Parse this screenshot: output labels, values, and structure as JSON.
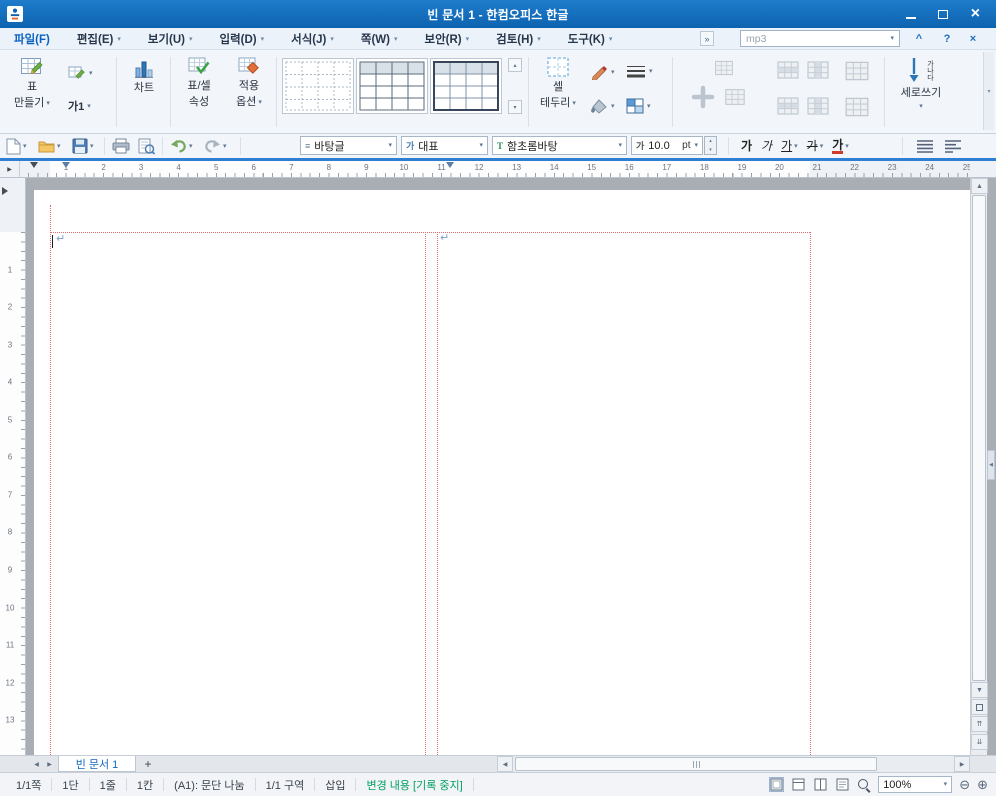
{
  "colors": {
    "titlebar_top": "#1e7ccb",
    "titlebar_bottom": "#0d63b0",
    "accent_line": "#2e7fd2",
    "margin_guide": "#e06a6a",
    "track_changes": "#00a05f",
    "file_menu": "#0b62c3"
  },
  "window": {
    "title": "빈 문서 1 - 한컴오피스 한글"
  },
  "menubar": {
    "items": [
      {
        "label": "파일(F)",
        "arrow": "",
        "key": "file"
      },
      {
        "label": "편집(E)",
        "arrow": "▾",
        "key": "edit"
      },
      {
        "label": "보기(U)",
        "arrow": "▾",
        "key": "view"
      },
      {
        "label": "입력(D)",
        "arrow": "▾",
        "key": "input"
      },
      {
        "label": "서식(J)",
        "arrow": "▾",
        "key": "format"
      },
      {
        "label": "쪽(W)",
        "arrow": "▾",
        "key": "page"
      },
      {
        "label": "보안(R)",
        "arrow": "▾",
        "key": "security"
      },
      {
        "label": "검토(H)",
        "arrow": "▾",
        "key": "review"
      },
      {
        "label": "도구(K)",
        "arrow": "▾",
        "key": "tools"
      }
    ],
    "overflow": "»",
    "search_value": "mp3",
    "collapse": "^",
    "help": "?",
    "close": "×"
  },
  "ribbon": {
    "make_table_line1": "표",
    "make_table_line2": "만들기",
    "ga1_label": "가1",
    "chart_label": "차트",
    "props_line1": "표/셀",
    "props_line2": "속성",
    "apply_line1": "적용",
    "apply_line2": "옵션",
    "cell_border_line1": "셀",
    "cell_border_line2": "테두리",
    "vertical_label": "세로쓰기",
    "vertical_icon_text": "가나다"
  },
  "toolbar": {
    "style_value": "바탕글",
    "font_type_value": "대표",
    "font_value": "함초롬바탕",
    "size_value": "10.0",
    "size_unit": "pt",
    "char_buttons": [
      {
        "label": "가",
        "kind": "bold",
        "dd": false
      },
      {
        "label": "가",
        "kind": "italic",
        "dd": false
      },
      {
        "label": "가",
        "kind": "underline",
        "dd": true
      },
      {
        "label": "가",
        "kind": "strike",
        "dd": true
      },
      {
        "label": "가",
        "kind": "color",
        "dd": true
      }
    ]
  },
  "rulers": {
    "h_numbers": [
      1,
      2,
      3,
      4,
      5,
      6,
      7,
      8,
      9,
      10,
      11,
      12,
      13,
      14,
      15,
      16,
      17,
      18,
      19,
      20,
      21,
      22,
      23,
      24,
      25
    ],
    "v_numbers": [
      1,
      2,
      3,
      4,
      5,
      6,
      7,
      8,
      9,
      10,
      11,
      12,
      13
    ]
  },
  "tabbar": {
    "tab_label": "빈 문서 1",
    "add_label": "+"
  },
  "statusbar": {
    "items": [
      "1/1쪽",
      "1단",
      "1줄",
      "1칸",
      "(A1): 문단 나눔",
      "1/1 구역",
      "삽입"
    ],
    "track_changes": "변경 내용 [기록 중지]",
    "zoom_value": "100%"
  },
  "icons": {
    "dropdown": "▾",
    "spinner_up": "▴",
    "spinner_down": "▾",
    "scroll_up": "▲",
    "scroll_down": "▼",
    "scroll_left": "◀",
    "scroll_right": "▶",
    "page_up": "⇈",
    "page_down": "⇊",
    "tab_prev": "◀",
    "tab_next": "▶",
    "para_mark": "↵",
    "zoom_out": "⊖",
    "zoom_in": "⊕",
    "corner_tab": "▶",
    "window_close": "×",
    "style_icon": "≡",
    "font_type_icon": "가",
    "font_face_icon": "T",
    "size_icon": "가",
    "panel_handle": "◀"
  }
}
